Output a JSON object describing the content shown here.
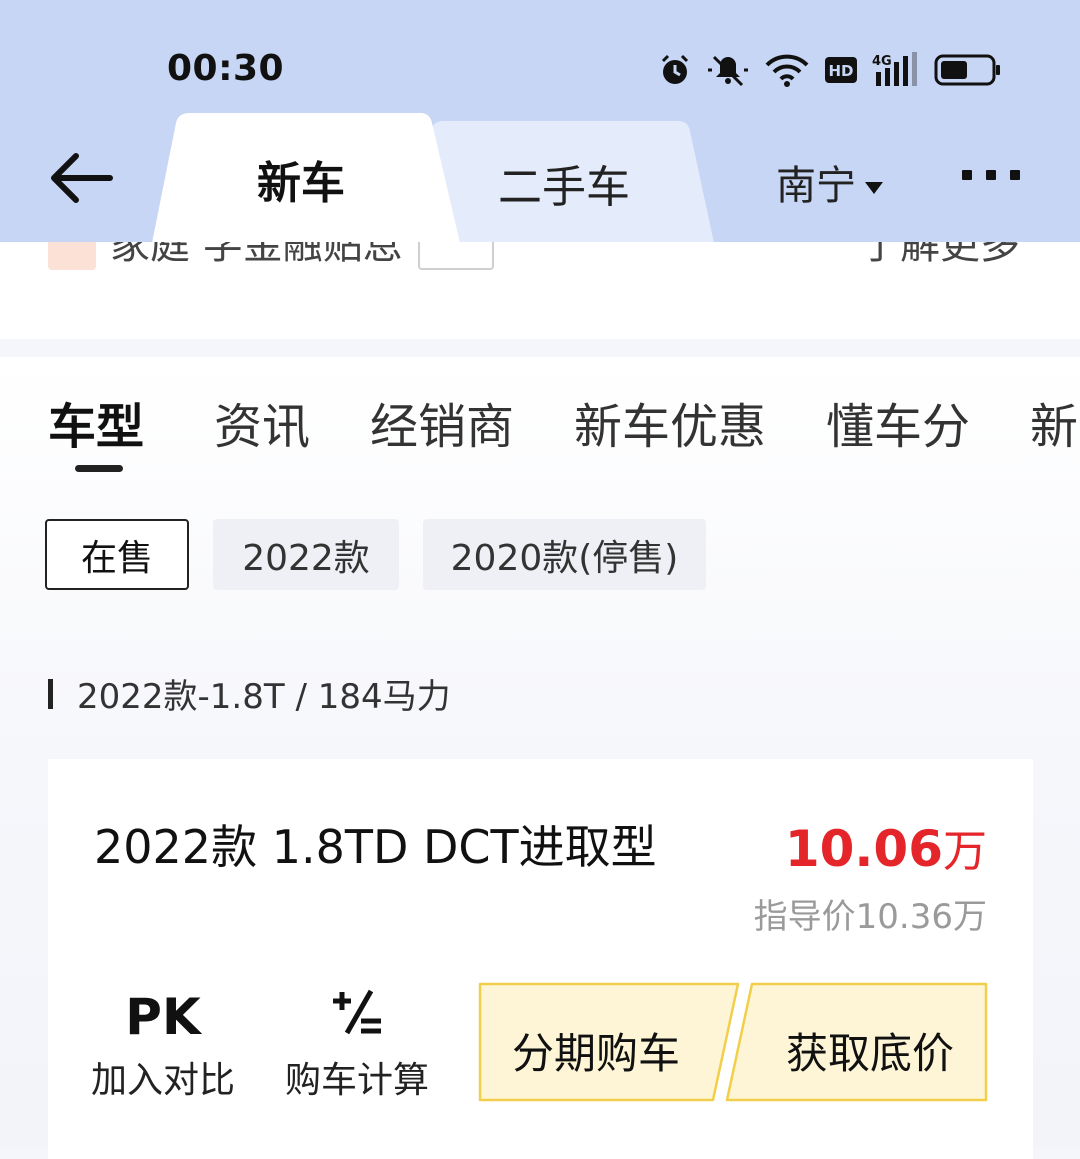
{
  "status": {
    "time": "00:30"
  },
  "header": {
    "tabs": [
      {
        "label": "新车"
      },
      {
        "label": "二手车"
      }
    ],
    "city": "南宁"
  },
  "strip": {
    "left_text": "家庭 学金融贴息",
    "right_text": "了解更多"
  },
  "subtabs": [
    "车型",
    "资讯",
    "经销商",
    "新车优惠",
    "懂车分",
    "新"
  ],
  "chips": [
    "在售",
    "2022款",
    "2020款(停售)"
  ],
  "group_title": "2022款-1.8T / 184马力",
  "card": {
    "name": "2022款 1.8TD DCT进取型",
    "price_value": "10.06",
    "price_unit": "万",
    "guide_price": "指导价10.36万",
    "actions": [
      {
        "glyph": "PK",
        "label": "加入对比"
      },
      {
        "glyph": "+/=",
        "label": "购车计算"
      }
    ],
    "buttons": [
      "分期购车",
      "获取底价"
    ]
  },
  "colors": {
    "header_bg": "#c8d6f5",
    "price": "#e4262b",
    "button_bg": "#fdf5d6",
    "button_border": "#f1cf4a"
  }
}
